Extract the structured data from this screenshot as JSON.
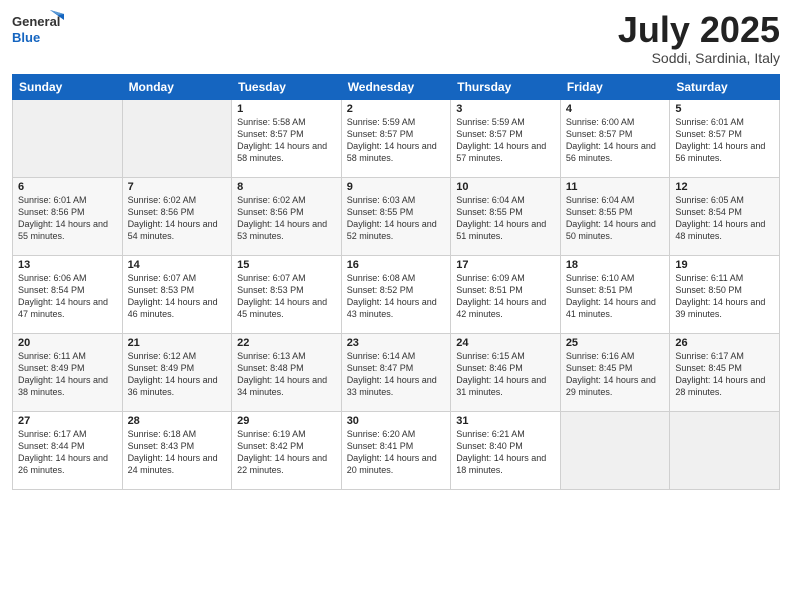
{
  "header": {
    "logo": {
      "general": "General",
      "blue": "Blue"
    },
    "title": "July 2025",
    "subtitle": "Soddi, Sardinia, Italy"
  },
  "weekdays": [
    "Sunday",
    "Monday",
    "Tuesday",
    "Wednesday",
    "Thursday",
    "Friday",
    "Saturday"
  ],
  "weeks": [
    [
      {
        "day": null
      },
      {
        "day": null
      },
      {
        "day": "1",
        "sunrise": "5:58 AM",
        "sunset": "8:57 PM",
        "daylight": "14 hours and 58 minutes."
      },
      {
        "day": "2",
        "sunrise": "5:59 AM",
        "sunset": "8:57 PM",
        "daylight": "14 hours and 58 minutes."
      },
      {
        "day": "3",
        "sunrise": "5:59 AM",
        "sunset": "8:57 PM",
        "daylight": "14 hours and 57 minutes."
      },
      {
        "day": "4",
        "sunrise": "6:00 AM",
        "sunset": "8:57 PM",
        "daylight": "14 hours and 56 minutes."
      },
      {
        "day": "5",
        "sunrise": "6:01 AM",
        "sunset": "8:57 PM",
        "daylight": "14 hours and 56 minutes."
      }
    ],
    [
      {
        "day": "6",
        "sunrise": "6:01 AM",
        "sunset": "8:56 PM",
        "daylight": "14 hours and 55 minutes."
      },
      {
        "day": "7",
        "sunrise": "6:02 AM",
        "sunset": "8:56 PM",
        "daylight": "14 hours and 54 minutes."
      },
      {
        "day": "8",
        "sunrise": "6:02 AM",
        "sunset": "8:56 PM",
        "daylight": "14 hours and 53 minutes."
      },
      {
        "day": "9",
        "sunrise": "6:03 AM",
        "sunset": "8:55 PM",
        "daylight": "14 hours and 52 minutes."
      },
      {
        "day": "10",
        "sunrise": "6:04 AM",
        "sunset": "8:55 PM",
        "daylight": "14 hours and 51 minutes."
      },
      {
        "day": "11",
        "sunrise": "6:04 AM",
        "sunset": "8:55 PM",
        "daylight": "14 hours and 50 minutes."
      },
      {
        "day": "12",
        "sunrise": "6:05 AM",
        "sunset": "8:54 PM",
        "daylight": "14 hours and 48 minutes."
      }
    ],
    [
      {
        "day": "13",
        "sunrise": "6:06 AM",
        "sunset": "8:54 PM",
        "daylight": "14 hours and 47 minutes."
      },
      {
        "day": "14",
        "sunrise": "6:07 AM",
        "sunset": "8:53 PM",
        "daylight": "14 hours and 46 minutes."
      },
      {
        "day": "15",
        "sunrise": "6:07 AM",
        "sunset": "8:53 PM",
        "daylight": "14 hours and 45 minutes."
      },
      {
        "day": "16",
        "sunrise": "6:08 AM",
        "sunset": "8:52 PM",
        "daylight": "14 hours and 43 minutes."
      },
      {
        "day": "17",
        "sunrise": "6:09 AM",
        "sunset": "8:51 PM",
        "daylight": "14 hours and 42 minutes."
      },
      {
        "day": "18",
        "sunrise": "6:10 AM",
        "sunset": "8:51 PM",
        "daylight": "14 hours and 41 minutes."
      },
      {
        "day": "19",
        "sunrise": "6:11 AM",
        "sunset": "8:50 PM",
        "daylight": "14 hours and 39 minutes."
      }
    ],
    [
      {
        "day": "20",
        "sunrise": "6:11 AM",
        "sunset": "8:49 PM",
        "daylight": "14 hours and 38 minutes."
      },
      {
        "day": "21",
        "sunrise": "6:12 AM",
        "sunset": "8:49 PM",
        "daylight": "14 hours and 36 minutes."
      },
      {
        "day": "22",
        "sunrise": "6:13 AM",
        "sunset": "8:48 PM",
        "daylight": "14 hours and 34 minutes."
      },
      {
        "day": "23",
        "sunrise": "6:14 AM",
        "sunset": "8:47 PM",
        "daylight": "14 hours and 33 minutes."
      },
      {
        "day": "24",
        "sunrise": "6:15 AM",
        "sunset": "8:46 PM",
        "daylight": "14 hours and 31 minutes."
      },
      {
        "day": "25",
        "sunrise": "6:16 AM",
        "sunset": "8:45 PM",
        "daylight": "14 hours and 29 minutes."
      },
      {
        "day": "26",
        "sunrise": "6:17 AM",
        "sunset": "8:45 PM",
        "daylight": "14 hours and 28 minutes."
      }
    ],
    [
      {
        "day": "27",
        "sunrise": "6:17 AM",
        "sunset": "8:44 PM",
        "daylight": "14 hours and 26 minutes."
      },
      {
        "day": "28",
        "sunrise": "6:18 AM",
        "sunset": "8:43 PM",
        "daylight": "14 hours and 24 minutes."
      },
      {
        "day": "29",
        "sunrise": "6:19 AM",
        "sunset": "8:42 PM",
        "daylight": "14 hours and 22 minutes."
      },
      {
        "day": "30",
        "sunrise": "6:20 AM",
        "sunset": "8:41 PM",
        "daylight": "14 hours and 20 minutes."
      },
      {
        "day": "31",
        "sunrise": "6:21 AM",
        "sunset": "8:40 PM",
        "daylight": "14 hours and 18 minutes."
      },
      {
        "day": null
      },
      {
        "day": null
      }
    ]
  ],
  "labels": {
    "sunrise": "Sunrise:",
    "sunset": "Sunset:",
    "daylight": "Daylight:"
  }
}
